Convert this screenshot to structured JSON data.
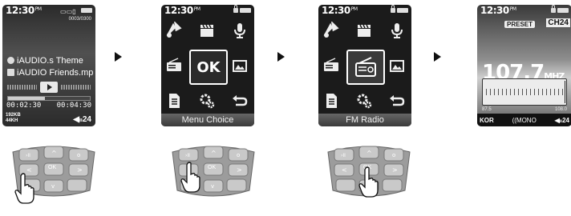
{
  "screen1": {
    "time": "12:30",
    "ampm": "PM",
    "track_counter": "0003/0300",
    "line1": "iAUDIO.s Theme",
    "line2": "iAUDIO Friends.mp",
    "progress": 0.45,
    "elapsed": "00:02:30",
    "total": "00:04:30",
    "bitrate": "192KB",
    "samplerate": "44KH",
    "volume": "24"
  },
  "screen2": {
    "time": "12:30",
    "ampm": "PM",
    "center": "OK",
    "caption": "Menu Choice"
  },
  "screen3": {
    "time": "12:30",
    "ampm": "PM",
    "caption": "FM Radio"
  },
  "screen4": {
    "time": "12:30",
    "ampm": "PM",
    "preset": "PRESET",
    "channel": "CH24",
    "frequency": "107.7",
    "unit": "MHZ",
    "range_min": "87.5",
    "range_max": "108.0",
    "region": "KOR",
    "mode": "MONO",
    "volume": "24"
  },
  "keypad": {
    "ok": "OK"
  },
  "icons": [
    "music-icon",
    "clapper-icon",
    "microphone-icon",
    "radio-icon",
    "image-icon",
    "document-icon",
    "settings-icon",
    "back-icon"
  ]
}
